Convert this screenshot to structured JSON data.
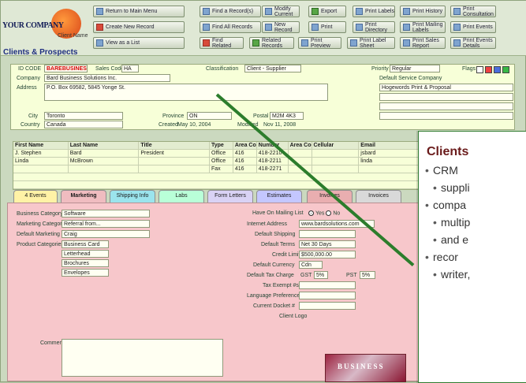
{
  "header": {
    "logo_text": "YOUR COMPANY",
    "logo_sub": "Client Name",
    "section_title": "Clients & Prospects"
  },
  "toolbar": {
    "buttons": [
      "Return to Main Menu",
      "Create New Record",
      "View as a List",
      "Find a Record(s)",
      "Find All Records",
      "Find Related",
      "Modify Current",
      "New Record",
      "Related Records",
      "Export",
      "Print",
      "Print Preview",
      "Print Labels",
      "Print Directory",
      "Print Label Sheet",
      "Print Labels",
      "Print History",
      "Print Mailing Labels",
      "Print Sales Report",
      "Print Consultation",
      "Print Events",
      "Print Events Details"
    ]
  },
  "record": {
    "id_code_label": "ID CODE",
    "id_code": "BAREBUSINES",
    "sales_code_label": "Sales Code",
    "sales_code": "HA",
    "classification_label": "Classification",
    "classification": "Client - Supplier",
    "priority_label": "Priority",
    "priority": "Regular",
    "flags_label": "Flags",
    "company_label": "Company",
    "company": "Bard Business Solutions Inc.",
    "address_label": "Address",
    "address": "P.O. Box 69582, 5845 Yonge St.",
    "default_service_label": "Default Service Company",
    "default_service": "Hogewords Print & Proposal",
    "city_label": "City",
    "city": "Toronto",
    "province_label": "Province",
    "province": "ON",
    "postal_label": "Postal",
    "postal": "M2M 4K3",
    "country_label": "Country",
    "country": "Canada",
    "created_label": "Created",
    "created": "May 10, 2004",
    "modified_label": "Modified",
    "modified": "Nov 11, 2008"
  },
  "contacts": {
    "headers": [
      "First Name",
      "Last Name",
      "Title",
      "Type",
      "Area Code",
      "Number",
      "Area Code",
      "Cellular",
      "Email"
    ],
    "rows": [
      [
        "J. Stephen",
        "Bard",
        "President",
        "Office",
        "416",
        "418-2210",
        "",
        "",
        "jsbard"
      ],
      [
        "Linda",
        "McBrown",
        "",
        "Office",
        "416",
        "418-2211",
        "",
        "",
        "linda"
      ],
      [
        "",
        "",
        "",
        "Fax",
        "416",
        "418-2271",
        "",
        "",
        ""
      ]
    ]
  },
  "tabs": [
    "4 Events",
    "Marketing",
    "Shipping Info",
    "Labs",
    "Form Letters",
    "Estimates",
    "Invoices",
    "Invoices"
  ],
  "marketing": {
    "business_category_label": "Business Category",
    "business_category": "Software",
    "referral_label": "Marketing Category",
    "referral": "Referral from...",
    "default_marketing_label": "Default Marketing",
    "default_marketing": "Craig",
    "product_categories_label": "Product Categories",
    "product_categories": [
      "Business Card",
      "Letterhead",
      "Brochures",
      "Envelopes"
    ],
    "comments_label": "Comments",
    "mailing_label": "Have On Mailing List",
    "mailing_yes": "Yes",
    "mailing_no": "No",
    "website_label": "Internet Address",
    "website": "www.bardsolutions.com",
    "default_shipping_label": "Default Shipping",
    "default_terms_label": "Default Terms",
    "default_terms": "Net 30 Days",
    "credit_limit_label": "Credit Limit",
    "credit_limit": "$500,000.00",
    "currency_label": "Default Currency",
    "currency": "Cdn",
    "tax_label": "Default Tax Charge",
    "gst": "GST",
    "gst_rate": "5%",
    "pst": "PST",
    "pst_rate": "5%",
    "tax_exempt_label": "Tax Exempt #s",
    "language_label": "Language Preference",
    "current_docket_label": "Current Docket #",
    "client_logo_label": "Client Logo",
    "logo_text": "BUSINESS"
  },
  "overlay": {
    "title": "Clients",
    "bullets": [
      "CRM",
      "suppli",
      "compa",
      "multip",
      "and e",
      "recor",
      "writer,"
    ]
  },
  "colors": {
    "accent": "#1f2f80",
    "highlight": "#2c7d2c",
    "pink_tab_area": "#f7c7cb"
  }
}
